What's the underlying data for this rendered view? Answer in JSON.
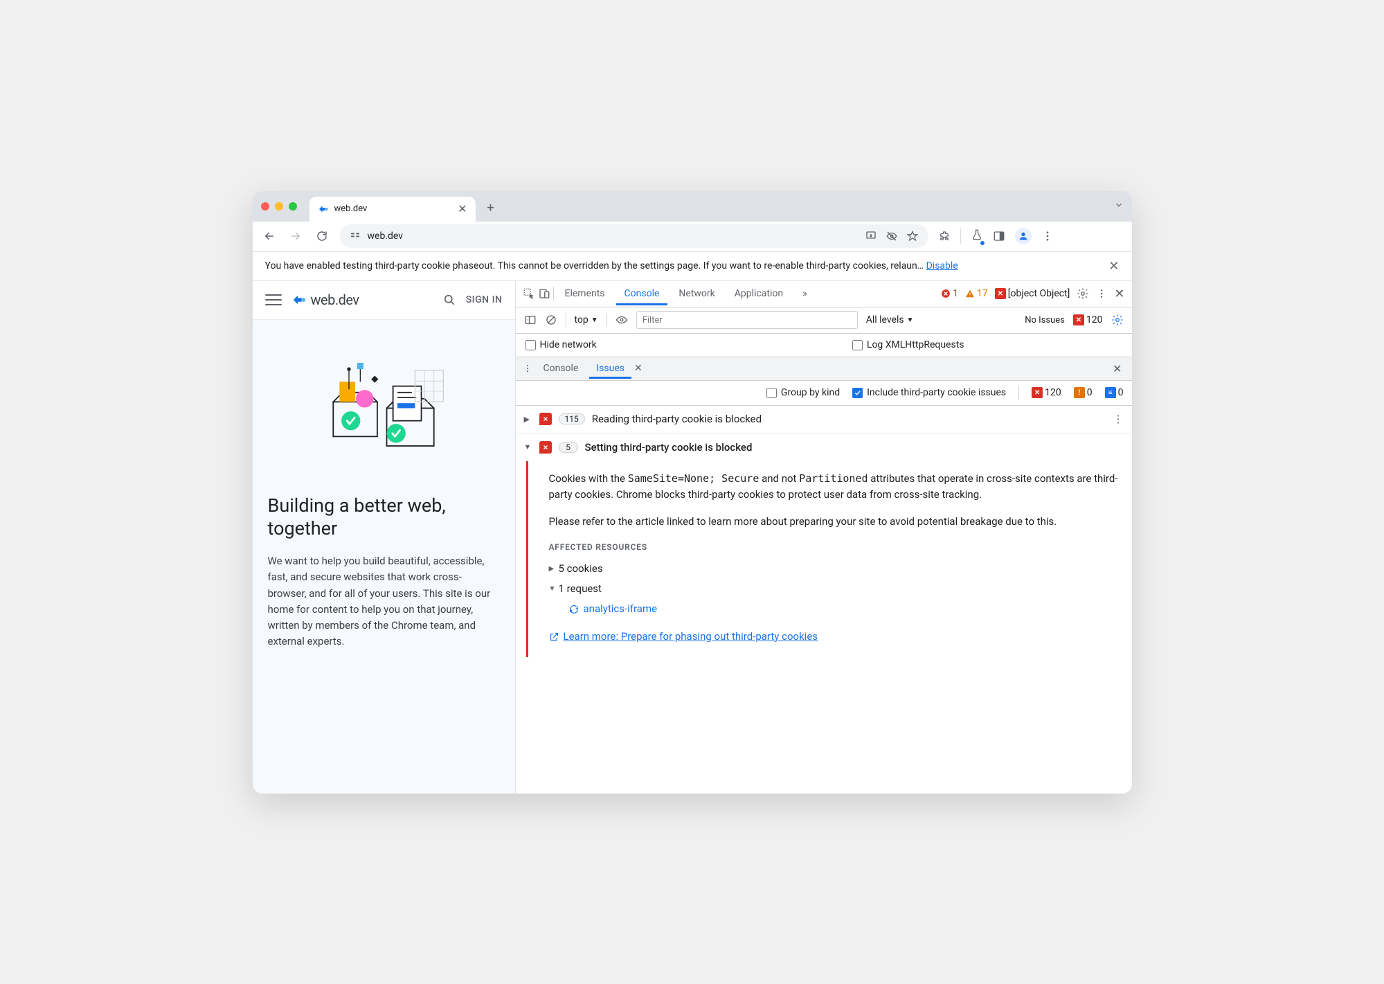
{
  "chrome": {
    "tab_title": "web.dev",
    "address": "web.dev"
  },
  "infobar": {
    "text": "You have enabled testing third-party cookie phaseout. This cannot be overridden by the settings page. If you want to re-enable third-party cookies, relaun…",
    "link": "Disable"
  },
  "page": {
    "site_name": "web.dev",
    "signin": "SIGN IN",
    "heading": "Building a better web, together",
    "paragraph": "We want to help you build beautiful, accessible, fast, and secure websites that work cross-browser, and for all of your users. This site is our home for content to help you on that journey, written by members of the Chrome team, and external experts."
  },
  "devtools": {
    "tabs": [
      "Elements",
      "Console",
      "Network",
      "Application"
    ],
    "active_tab": "Console",
    "errors": 1,
    "warnings": 17,
    "issues": {
      "group_label": "Group by kind",
      "include_label": "Include third-party cookie issues",
      "counts": {
        "red": 120,
        "orange": 0,
        "blue": 0
      },
      "items": [
        {
          "count": 115,
          "title": "Reading third-party cookie is blocked",
          "expanded": false
        },
        {
          "count": 5,
          "title": "Setting third-party cookie is blocked",
          "expanded": true
        }
      ],
      "detail": {
        "p1a": "Cookies with the ",
        "code1": "SameSite=None; Secure",
        "p1b": " and not ",
        "code2": "Partitioned",
        "p1c": " attributes that operate in cross-site contexts are third-party cookies. Chrome blocks third-party cookies to protect user data from cross-site tracking.",
        "p2": "Please refer to the article linked to learn more about preparing your site to avoid potential breakage due to this.",
        "affected_heading": "AFFECTED RESOURCES",
        "cookies": "5 cookies",
        "requests": "1 request",
        "request_name": "analytics-iframe",
        "learn_more": "Learn more: Prepare for phasing out third-party cookies"
      }
    },
    "console": {
      "context": "top",
      "filter_placeholder": "Filter",
      "level": "All levels",
      "no_issues_label": "No Issues",
      "no_issues_count": 120,
      "hide_network_label": "Hide network",
      "log_xhr_label": "Log XMLHttpRequests"
    },
    "drawer": {
      "tabs": [
        "Console",
        "Issues"
      ],
      "active": "Issues"
    }
  }
}
